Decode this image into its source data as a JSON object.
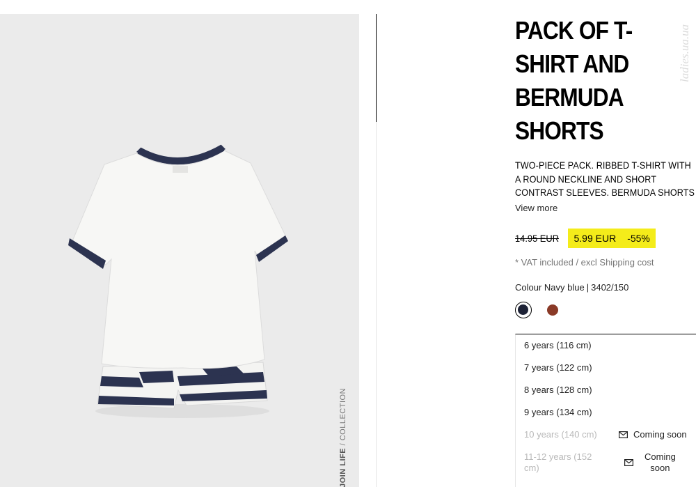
{
  "collection_tag": {
    "prefix": "JOIN LIFE",
    "suffix": " / COLLECTION"
  },
  "watermark": "ladies.ua.ua",
  "product": {
    "title_lines": [
      "PACK OF T-",
      "SHIRT AND",
      "BERMUDA",
      "SHORTS"
    ],
    "description_lines": [
      "TWO-PIECE PACK. RIBBED T-SHIRT WITH",
      "A ROUND NECKLINE AND SHORT",
      "CONTRAST SLEEVES. BERMUDA SHORTS"
    ],
    "view_more": "View more",
    "old_price": "14.95 EUR",
    "sale_price": "5.99 EUR",
    "discount": "-55%",
    "vat_note": "* VAT included / excl Shipping cost",
    "colour_label": "Colour Navy blue",
    "colour_separator": "|",
    "reference": "3402/150"
  },
  "colours": [
    {
      "name": "navy-blue",
      "hex": "#1d2236",
      "selected": true
    },
    {
      "name": "brown",
      "hex": "#8a3a27",
      "selected": false
    }
  ],
  "sizes": [
    {
      "label": "6 years (116 cm)",
      "available": true
    },
    {
      "label": "7 years (122 cm)",
      "available": true
    },
    {
      "label": "8 years (128 cm)",
      "available": true
    },
    {
      "label": "9 years (134 cm)",
      "available": true
    },
    {
      "label": "10 years (140 cm)",
      "available": false,
      "status": "Coming soon"
    },
    {
      "label_line1": "11-12 years (152",
      "label_line2": "cm)",
      "available": false,
      "status_line1": "Coming",
      "status_line2": "soon"
    }
  ],
  "icons": {
    "notify": "mail-icon"
  },
  "colors": {
    "sale_highlight": "#f4ec1a",
    "photo_bg": "#ebebeb"
  }
}
